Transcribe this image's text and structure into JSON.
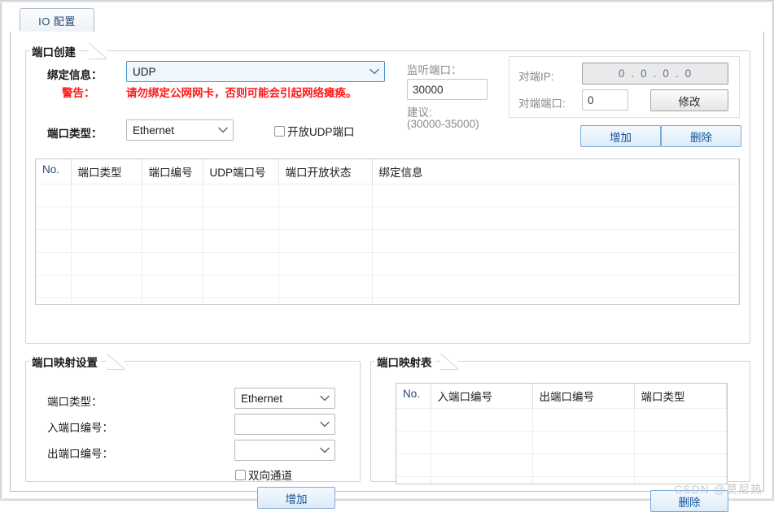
{
  "window": {
    "tabs": [
      {
        "label": "IO 配置",
        "active": true
      }
    ]
  },
  "port_create": {
    "title": "端口创建",
    "binding_label": "绑定信息：",
    "binding_value": "UDP",
    "binding_options": [
      "UDP"
    ],
    "warning_label": "警告：",
    "warning_text": "请勿绑定公网网卡，否则可能会引起网络瘫痪。",
    "warning_color": "#ff1a1a",
    "port_type_label": "端口类型：",
    "port_type_value": "Ethernet",
    "port_type_options": [
      "Ethernet"
    ],
    "open_udp_label": "开放UDP端口",
    "open_udp_checked": false,
    "listen_port_label": "监听端口：",
    "listen_port_value": "30000",
    "suggest_label": "建议:",
    "suggest_range": "(30000-35000)",
    "peer_ip_label": "对端IP:",
    "peer_ip_octets": [
      "0",
      "0",
      "0",
      "0"
    ],
    "peer_port_label": "对端端口:",
    "peer_port_value": "0",
    "modify_button": "修改",
    "add_button": "增加",
    "delete_button": "删除"
  },
  "port_table": {
    "columns": [
      "No.",
      "端口类型",
      "端口编号",
      "UDP端口号",
      "端口开放状态",
      "绑定信息"
    ],
    "rows": [],
    "empty_row_count": 6
  },
  "mapping_settings": {
    "title": "端口映射设置",
    "port_type_label": "端口类型：",
    "port_type_value": "Ethernet",
    "in_port_label": "入端口编号：",
    "in_port_value": "",
    "out_port_label": "出端口编号：",
    "out_port_value": "",
    "bidirectional_label": "双向通道",
    "bidirectional_checked": false,
    "add_button": "增加"
  },
  "mapping_table": {
    "title": "端口映射表",
    "columns": [
      "No.",
      "入端口编号",
      "出端口编号",
      "端口类型"
    ],
    "rows": [],
    "empty_row_count": 4,
    "delete_button": "删除"
  },
  "watermark": "CSDN @莫尼热"
}
